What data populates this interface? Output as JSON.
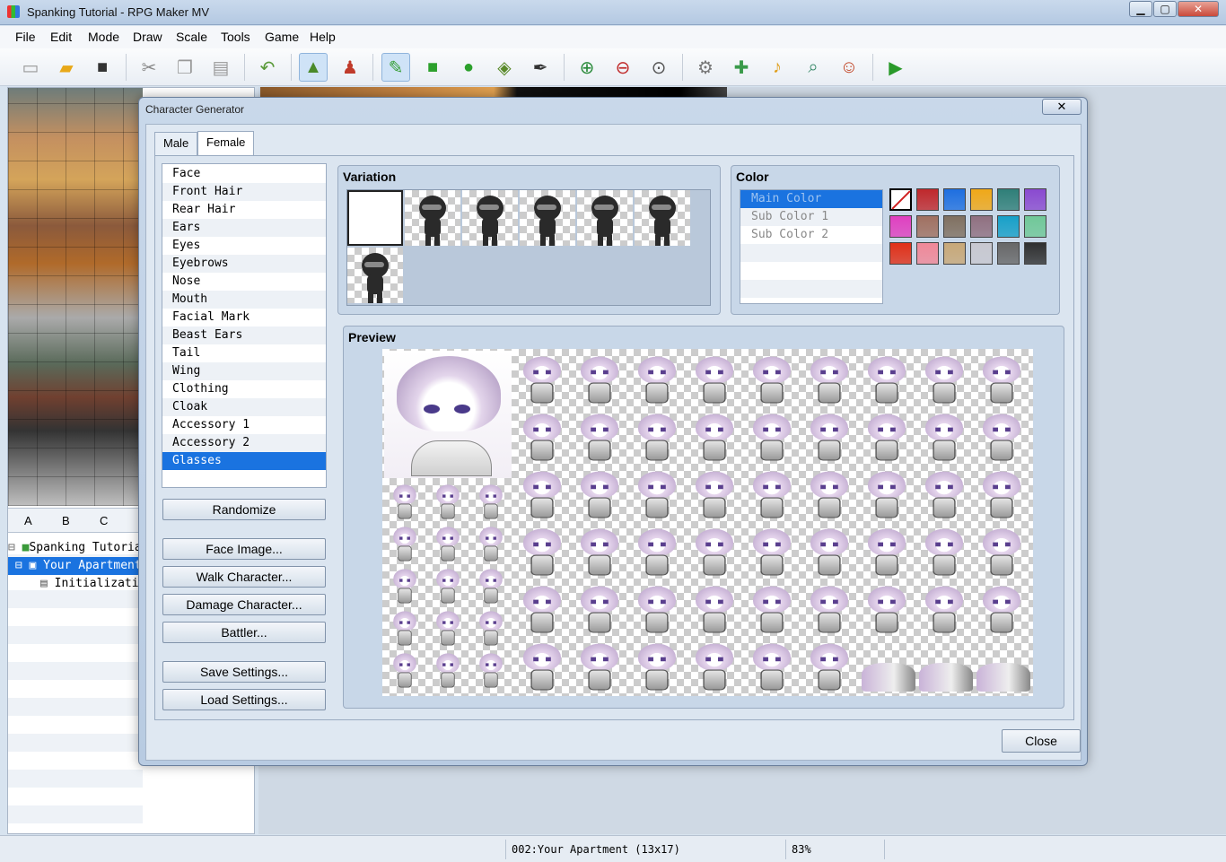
{
  "window": {
    "title": "Spanking Tutorial - RPG Maker MV",
    "min": "▁",
    "max": "▢",
    "close": "✕"
  },
  "menu": [
    "File",
    "Edit",
    "Mode",
    "Draw",
    "Scale",
    "Tools",
    "Game",
    "Help"
  ],
  "toolbar_icons": [
    "new-project-icon",
    "open-project-icon",
    "save-project-icon",
    "cut-icon",
    "copy-icon",
    "paste-icon",
    "undo-icon",
    "map-mode-icon",
    "event-mode-icon",
    "pencil-icon",
    "rectangle-icon",
    "ellipse-icon",
    "fill-icon",
    "shadow-pen-icon",
    "zoom-in-icon",
    "zoom-out-icon",
    "actual-size-icon",
    "database-icon",
    "plugin-manager-icon",
    "sound-test-icon",
    "event-searcher-icon",
    "character-generator-icon",
    "playtest-icon"
  ],
  "left_tabs": [
    "A",
    "B",
    "C"
  ],
  "map_tree": {
    "project": "Spanking Tutorial",
    "map": "Your Apartment",
    "child": "Initialization"
  },
  "dialog": {
    "title": "Character Generator",
    "close_x": "✕",
    "gender_tabs": [
      "Male",
      "Female"
    ],
    "active_tab": "Female",
    "parts": [
      "Face",
      "Front Hair",
      "Rear Hair",
      "Ears",
      "Eyes",
      "Eyebrows",
      "Nose",
      "Mouth",
      "Facial Mark",
      "Beast Ears",
      "Tail",
      "Wing",
      "Clothing",
      "Cloak",
      "Accessory 1",
      "Accessory 2",
      "Glasses"
    ],
    "selected_part": "Glasses",
    "buttons": {
      "randomize": "Randomize",
      "face_image": "Face Image...",
      "walk_character": "Walk Character...",
      "damage_character": "Damage Character...",
      "battler": "Battler...",
      "save_settings": "Save Settings...",
      "load_settings": "Load Settings..."
    },
    "variation": {
      "title": "Variation",
      "count": 7,
      "selected_index": 0
    },
    "color": {
      "title": "Color",
      "slots": [
        "Main Color",
        "Sub Color 1",
        "Sub Color 2"
      ],
      "selected_slot": "Main Color",
      "swatches": [
        "none",
        "#c0282c",
        "#1e6fe0",
        "#f0a818",
        "#2f7f78",
        "#8a4ad0",
        "#e040c0",
        "#a07060",
        "#807060",
        "#907080",
        "#18a0c8",
        "#70c898",
        "#e03018",
        "#f08898",
        "#c8a878",
        "#c8c8d0",
        "#686868",
        "#303030"
      ]
    },
    "preview": {
      "title": "Preview"
    },
    "close_button": "Close"
  },
  "status": {
    "map_info": "002:Your Apartment (13x17)",
    "zoom": "83%"
  }
}
